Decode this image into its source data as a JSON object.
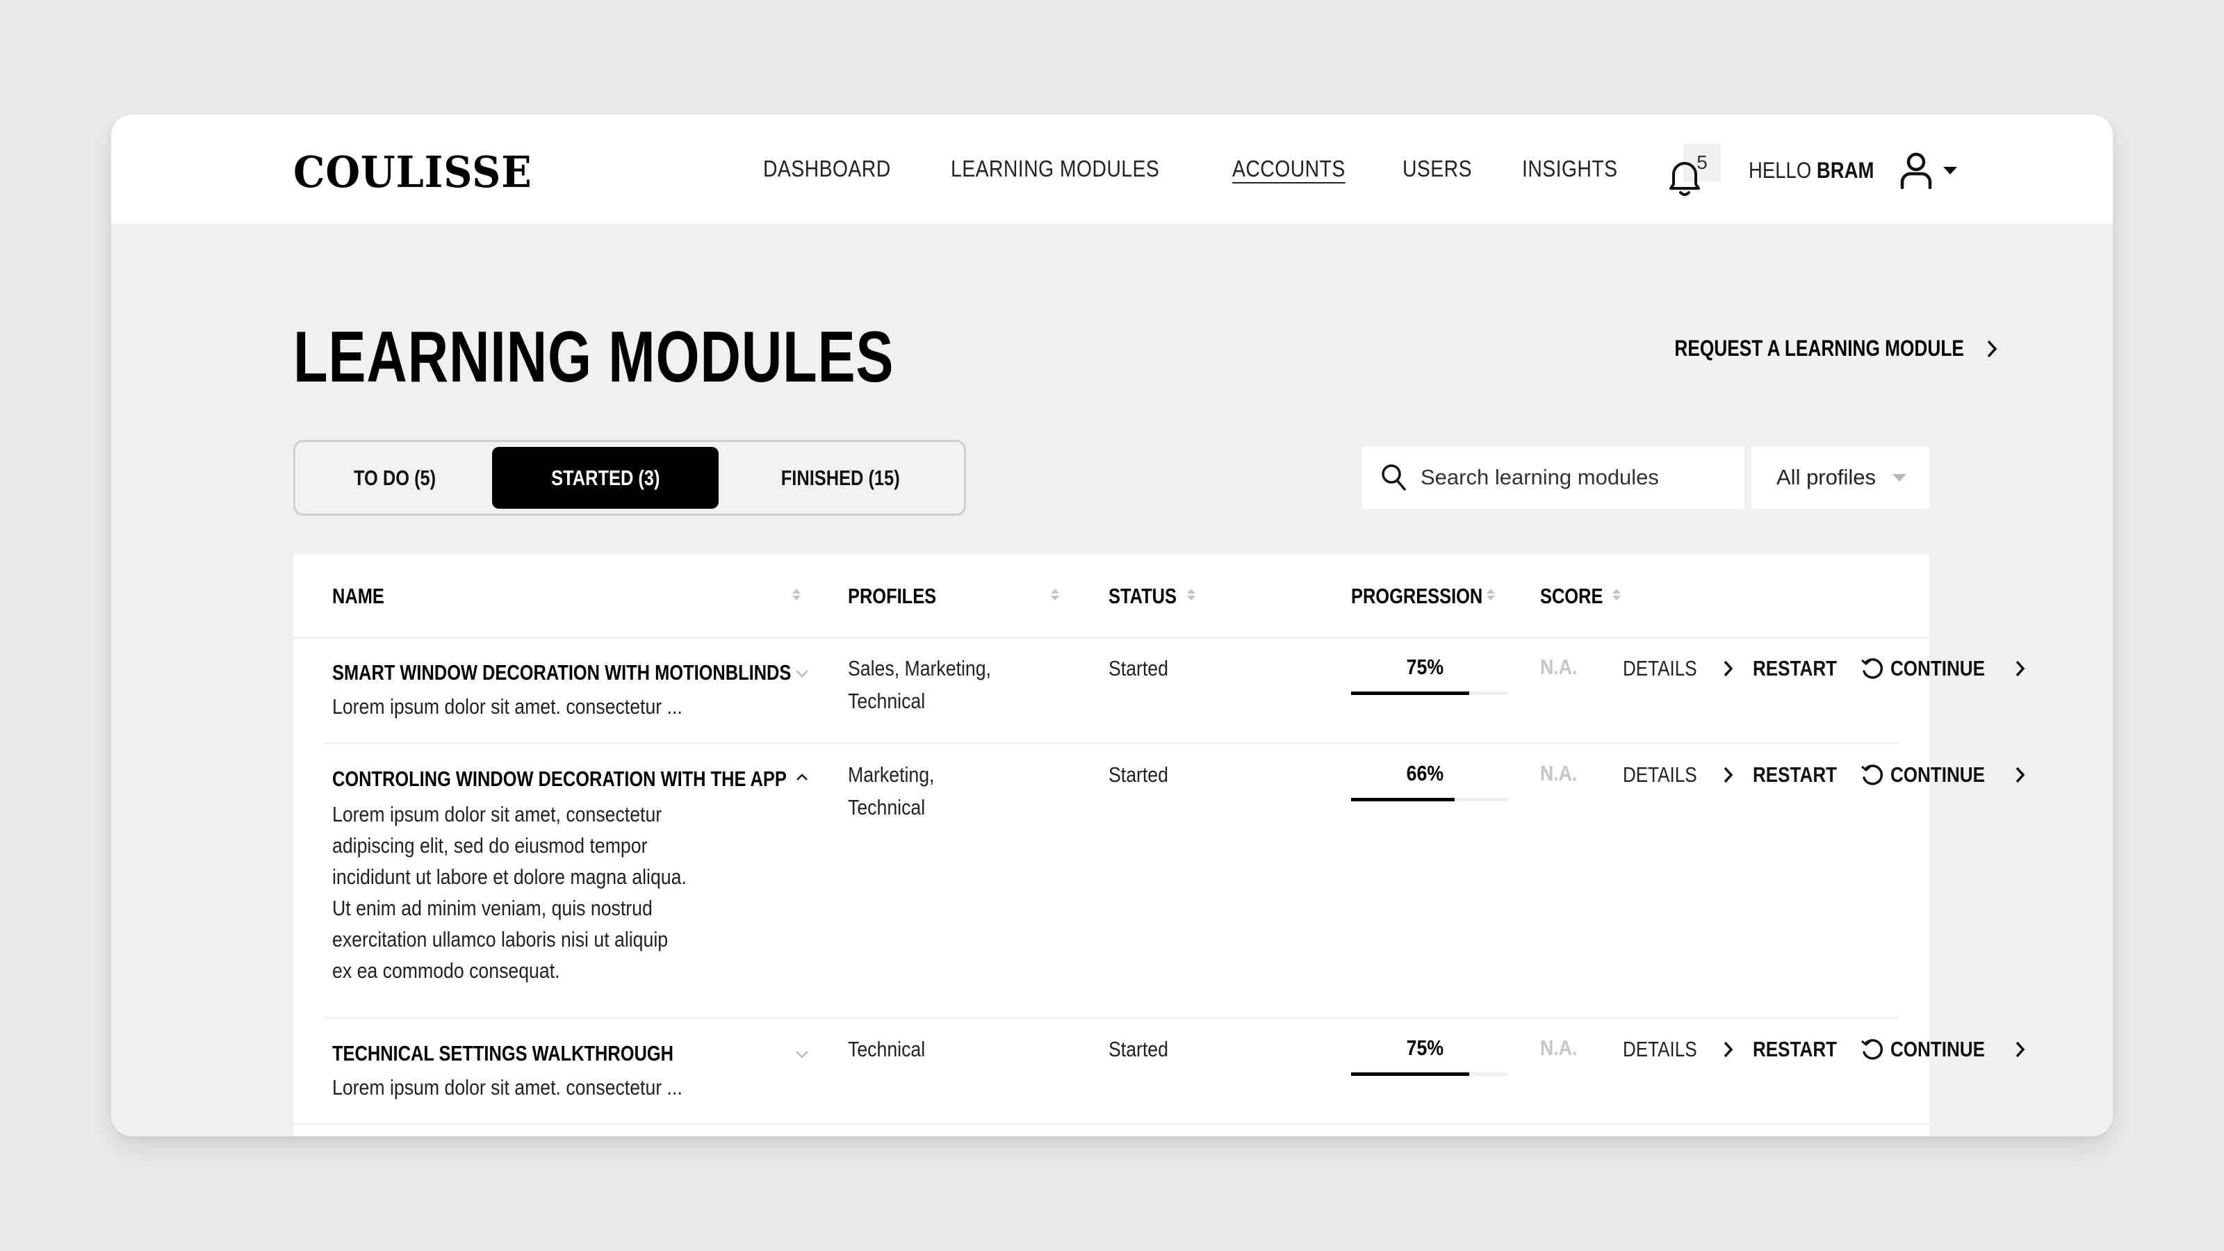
{
  "header": {
    "logo": "COULISSE",
    "nav": [
      {
        "label": "DASHBOARD",
        "active": false
      },
      {
        "label": "LEARNING MODULES",
        "active": false
      },
      {
        "label": "ACCOUNTS",
        "active": true
      },
      {
        "label": "USERS",
        "active": false
      },
      {
        "label": "INSIGHTS",
        "active": false
      }
    ],
    "notifications_count": "5",
    "greeting": "HELLO",
    "user_name": "BRAM"
  },
  "page": {
    "title": "LEARNING MODULES",
    "request_link": "REQUEST A LEARNING MODULE"
  },
  "tabs": [
    {
      "label": "TO DO (5)",
      "active": false
    },
    {
      "label": "STARTED (3)",
      "active": true
    },
    {
      "label": "FINISHED (15)",
      "active": false
    }
  ],
  "filters": {
    "search_placeholder": "Search learning modules",
    "search_value": "",
    "profile_select": "All profiles"
  },
  "table": {
    "columns": [
      "NAME",
      "PROFILES",
      "STATUS",
      "PROGRESSION",
      "SCORE"
    ],
    "actions": {
      "details": "DETAILS",
      "restart": "RESTART",
      "continue": "CONTINUE"
    },
    "rows": [
      {
        "name": "SMART WINDOW DECORATION WITH MOTIONBLINDS",
        "expanded": false,
        "description": [
          "Lorem ipsum dolor sit amet. consectetur ..."
        ],
        "profiles": [
          "Sales, Marketing,",
          "Technical"
        ],
        "status": "Started",
        "progress_label": "75%",
        "progress": 0.75,
        "score": "N.A."
      },
      {
        "name": "CONTROLING WINDOW DECORATION WITH THE APP",
        "expanded": true,
        "description": [
          "Lorem ipsum dolor sit amet, consectetur",
          "adipiscing elit, sed do eiusmod tempor",
          "incididunt ut labore et dolore magna aliqua.",
          "Ut enim ad minim veniam, quis nostrud",
          "exercitation ullamco laboris nisi ut aliquip",
          "ex ea commodo consequat."
        ],
        "profiles": [
          "Marketing,",
          "Technical"
        ],
        "status": "Started",
        "progress_label": "66%",
        "progress": 0.66,
        "score": "N.A."
      },
      {
        "name": "TECHNICAL SETTINGS WALKTHROUGH",
        "expanded": false,
        "description": [
          "Lorem ipsum dolor sit amet. consectetur ..."
        ],
        "profiles": [
          "Technical"
        ],
        "status": "Started",
        "progress_label": "75%",
        "progress": 0.75,
        "score": "N.A."
      }
    ]
  }
}
